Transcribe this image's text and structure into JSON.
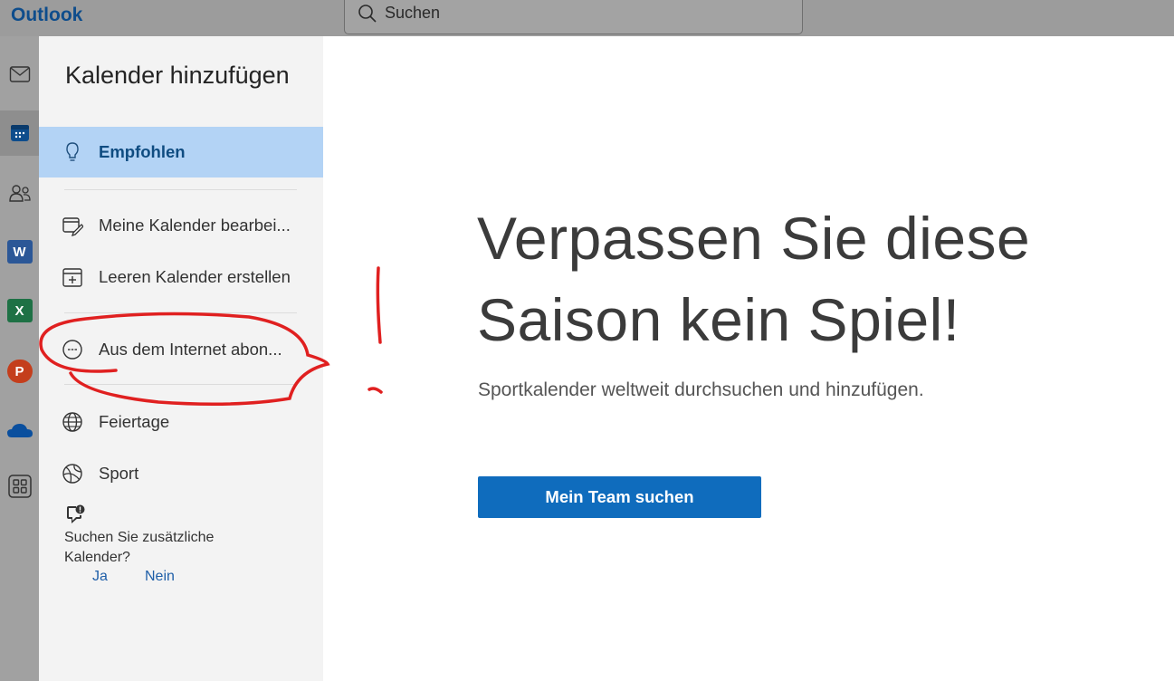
{
  "app": {
    "name": "Outlook"
  },
  "search": {
    "placeholder": "Suchen"
  },
  "rail": [
    {
      "id": "mail",
      "icon": "mail-icon"
    },
    {
      "id": "calendar",
      "icon": "calendar-icon",
      "active": true
    },
    {
      "id": "people",
      "icon": "people-icon"
    },
    {
      "id": "word",
      "icon": "word-app-icon",
      "letter": "W",
      "color": "#2b5797"
    },
    {
      "id": "excel",
      "icon": "excel-app-icon",
      "letter": "X",
      "color": "#1e7145"
    },
    {
      "id": "powerpoint",
      "icon": "powerpoint-app-icon",
      "letter": "P",
      "color": "#c43e1c"
    },
    {
      "id": "onedrive",
      "icon": "onedrive-icon"
    },
    {
      "id": "apps",
      "icon": "apps-grid-icon"
    }
  ],
  "dialog": {
    "title": "Kalender hinzufügen",
    "nav": [
      {
        "id": "recommended",
        "label": "Empfohlen",
        "icon": "lightbulb-icon",
        "selected": true
      },
      {
        "id": "edit",
        "label": "Meine Kalender bearbei...",
        "icon": "edit-calendar-icon"
      },
      {
        "id": "blank",
        "label": "Leeren Kalender erstellen",
        "icon": "calendar-add-icon"
      },
      {
        "id": "subscribe",
        "label": "Aus dem Internet abon...",
        "icon": "link-circle-icon"
      },
      {
        "id": "holidays",
        "label": "Feiertage",
        "icon": "globe-icon"
      },
      {
        "id": "sport",
        "label": "Sport",
        "icon": "sports-ball-icon"
      }
    ],
    "feedback": {
      "question": "Suchen Sie zusätzliche Kalender?",
      "yes": "Ja",
      "no": "Nein"
    },
    "main": {
      "headline": "Verpassen Sie diese Saison kein Spiel!",
      "subtitle": "Sportkalender weltweit durchsuchen und hinzufügen.",
      "button": "Mein Team suchen"
    }
  },
  "colors": {
    "accent": "#0f6cbd",
    "selected_bg": "#b3d3f5",
    "annotation": "#e02020"
  }
}
